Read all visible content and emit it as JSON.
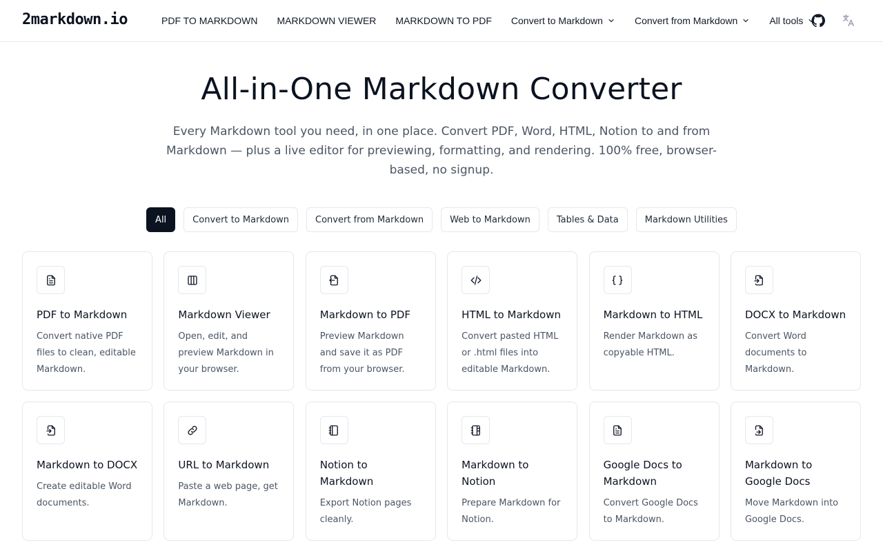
{
  "header": {
    "logo": "2markdown.io",
    "nav": [
      {
        "label": "PDF TO MARKDOWN",
        "dropdown": false
      },
      {
        "label": "MARKDOWN VIEWER",
        "dropdown": false
      },
      {
        "label": "MARKDOWN TO PDF",
        "dropdown": false
      },
      {
        "label": "Convert to Markdown",
        "dropdown": true
      },
      {
        "label": "Convert from Markdown",
        "dropdown": true
      },
      {
        "label": "All tools",
        "dropdown": true
      }
    ],
    "icons": [
      "github-icon",
      "translate-icon"
    ]
  },
  "hero": {
    "title": "All-in-One Markdown Converter",
    "subtitle": "Every Markdown tool you need, in one place. Convert PDF, Word, HTML, Notion to and from Markdown — plus a live editor for previewing, formatting, and rendering. 100% free, browser-based, no signup."
  },
  "filters": [
    {
      "label": "All",
      "active": true
    },
    {
      "label": "Convert to Markdown",
      "active": false
    },
    {
      "label": "Convert from Markdown",
      "active": false
    },
    {
      "label": "Web to Markdown",
      "active": false
    },
    {
      "label": "Tables & Data",
      "active": false
    },
    {
      "label": "Markdown Utilities",
      "active": false
    }
  ],
  "tools": [
    {
      "title": "PDF to Markdown",
      "desc": "Convert native PDF files to clean, editable Markdown.",
      "icon": "file-text-icon"
    },
    {
      "title": "Markdown Viewer",
      "desc": "Open, edit, and preview Markdown in your browser.",
      "icon": "columns-icon"
    },
    {
      "title": "Markdown to PDF",
      "desc": "Preview Markdown and save it as PDF from your browser.",
      "icon": "file-export-icon"
    },
    {
      "title": "HTML to Markdown",
      "desc": "Convert pasted HTML or .html files into editable Markdown.",
      "icon": "code-icon"
    },
    {
      "title": "Markdown to HTML",
      "desc": "Render Markdown as copyable HTML.",
      "icon": "braces-icon"
    },
    {
      "title": "DOCX to Markdown",
      "desc": "Convert Word documents to Markdown.",
      "icon": "file-import-icon"
    },
    {
      "title": "Markdown to DOCX",
      "desc": "Create editable Word documents.",
      "icon": "file-import-icon"
    },
    {
      "title": "URL to Markdown",
      "desc": "Paste a web page, get Markdown.",
      "icon": "link-icon"
    },
    {
      "title": "Notion to Markdown",
      "desc": "Export Notion pages cleanly.",
      "icon": "notebook-icon"
    },
    {
      "title": "Markdown to Notion",
      "desc": "Prepare Markdown for Notion.",
      "icon": "notebook-tabs-icon"
    },
    {
      "title": "Google Docs to Markdown",
      "desc": "Convert Google Docs to Markdown.",
      "icon": "file-text-icon"
    },
    {
      "title": "Markdown to Google Docs",
      "desc": "Move Markdown into Google Docs.",
      "icon": "file-input-icon"
    }
  ]
}
